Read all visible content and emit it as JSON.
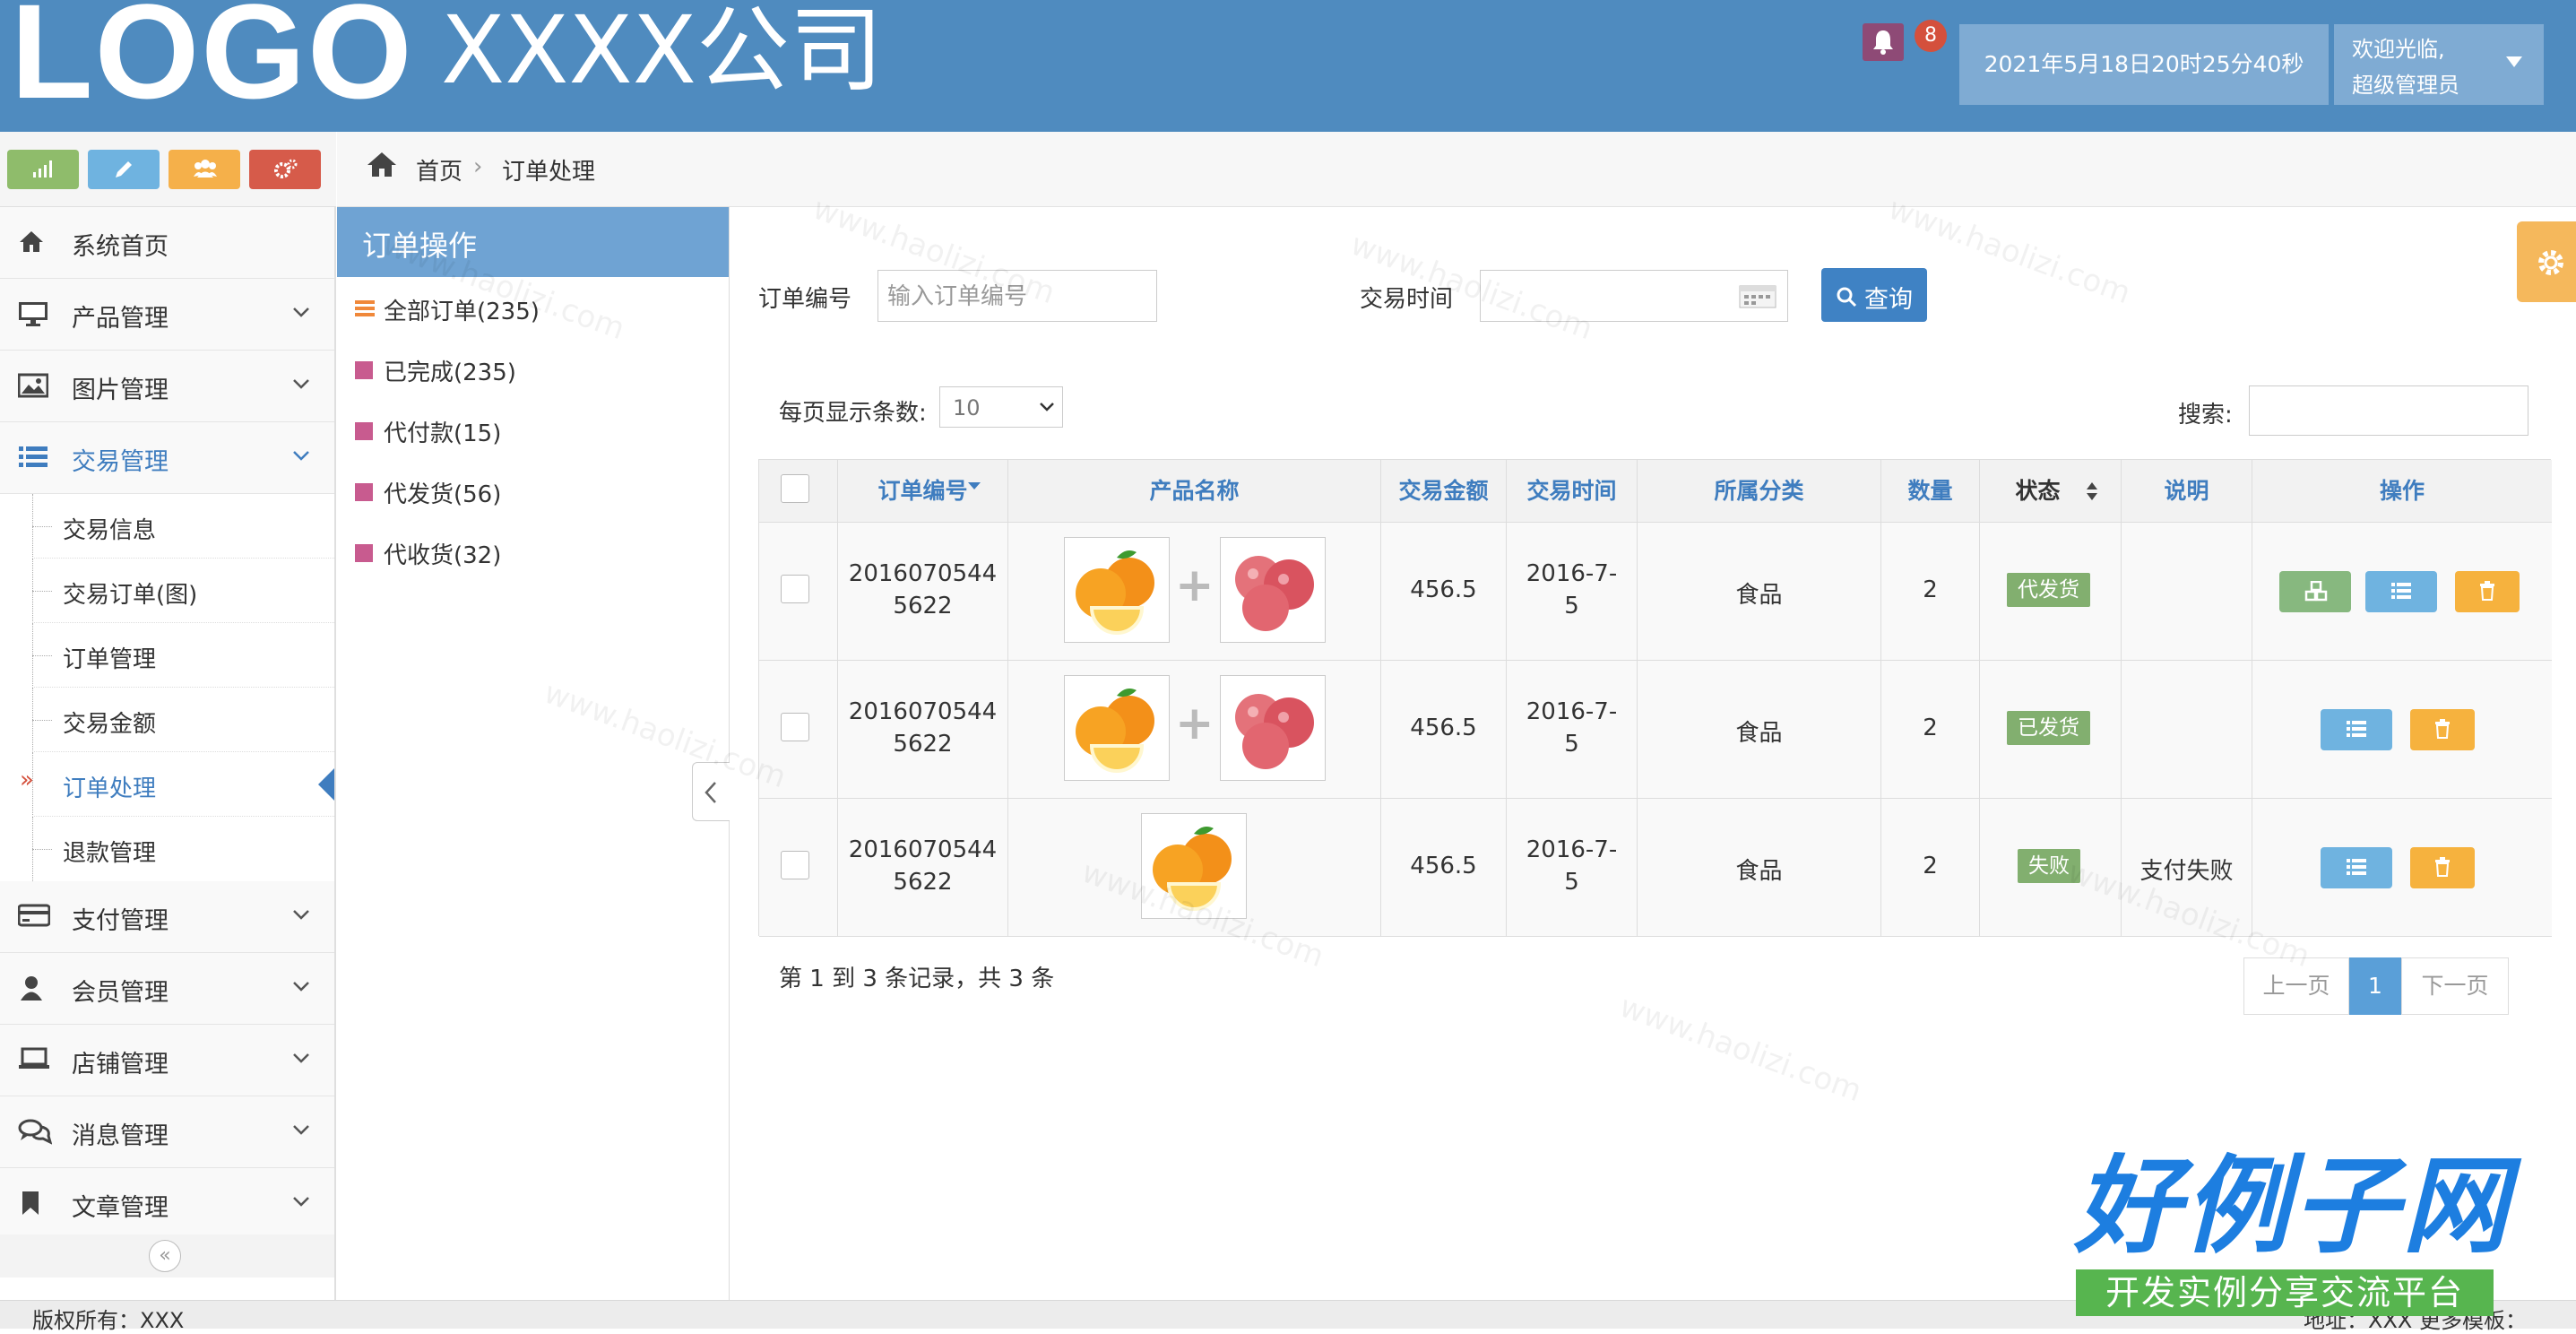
{
  "header": {
    "logo": "LOGO",
    "company": "XXXX公司",
    "notification_count": "8",
    "datetime": "2021年5月18日20时25分40秒",
    "welcome_line1": "欢迎光临,",
    "welcome_line2": "超级管理员"
  },
  "shortcut_colors": [
    "#8fbc6b",
    "#6fb3e0",
    "#f5b04a",
    "#d65b4a"
  ],
  "breadcrumb": {
    "home": "首页",
    "separator": "›",
    "current": "订单处理"
  },
  "sidebar": {
    "items": [
      {
        "label": "系统首页",
        "icon": "home-icon"
      },
      {
        "label": "产品管理",
        "icon": "monitor-icon"
      },
      {
        "label": "图片管理",
        "icon": "picture-icon"
      },
      {
        "label": "交易管理",
        "icon": "list-icon"
      },
      {
        "label": "支付管理",
        "icon": "credit-card-icon"
      },
      {
        "label": "会员管理",
        "icon": "user-icon"
      },
      {
        "label": "店铺管理",
        "icon": "laptop-icon"
      },
      {
        "label": "消息管理",
        "icon": "comments-icon"
      },
      {
        "label": "文章管理",
        "icon": "bookmark-icon"
      }
    ],
    "submenu": [
      "交易信息",
      "交易订单(图)",
      "订单管理",
      "交易金额",
      "订单处理",
      "退款管理"
    ],
    "active_submenu_marker": "»",
    "collapse_glyph": "«"
  },
  "ops": {
    "title": "订单操作",
    "items": [
      "全部订单(235)",
      "已完成(235)",
      "代付款(15)",
      "代发货(56)",
      "代收货(32)"
    ]
  },
  "filter": {
    "order_no_label": "订单编号",
    "order_no_placeholder": "输入订单编号",
    "trade_time_label": "交易时间",
    "query_button": "查询",
    "per_page_label": "每页显示条数:",
    "per_page_value": "10",
    "search_label": "搜索:"
  },
  "table": {
    "columns": [
      "订单编号",
      "产品名称",
      "交易金额",
      "交易时间",
      "所属分类",
      "数量",
      "状态",
      "说明",
      "操作"
    ],
    "rows": [
      {
        "order_no_1": "2016070544",
        "order_no_2": "5622",
        "amount": "456.5",
        "time_1": "2016-7-",
        "time_2": "5",
        "category": "食品",
        "qty": "2",
        "status": "代发货",
        "status_color": "#82af6f",
        "note": ""
      },
      {
        "order_no_1": "2016070544",
        "order_no_2": "5622",
        "amount": "456.5",
        "time_1": "2016-7-",
        "time_2": "5",
        "category": "食品",
        "qty": "2",
        "status": "已发货",
        "status_color": "#82af6f",
        "note": ""
      },
      {
        "order_no_1": "2016070544",
        "order_no_2": "5622",
        "amount": "456.5",
        "time_1": "2016-7-",
        "time_2": "5",
        "category": "食品",
        "qty": "2",
        "status": "失败",
        "status_color": "#82af6f",
        "note": "支付失败"
      }
    ]
  },
  "summary": "第 1 到 3 条记录，共 3 条",
  "pager": {
    "prev": "上一页",
    "current": "1",
    "next": "下一页"
  },
  "footer": {
    "copyright": "版权所有：XXX",
    "right": "地址：XXX 更多模板："
  },
  "brand": {
    "title": "好例子网",
    "subtitle": "开发实例分享交流平台",
    "watermark": "www.haolizi.com"
  }
}
